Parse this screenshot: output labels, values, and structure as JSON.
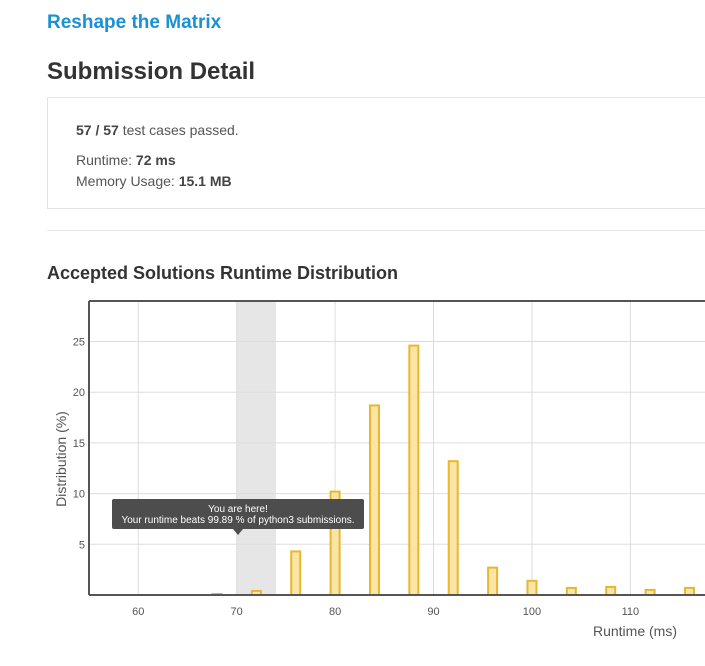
{
  "problem": {
    "title": "Reshape the Matrix"
  },
  "page_title": "Submission Detail",
  "summary": {
    "passed": "57",
    "separator": " / ",
    "total": "57",
    "passed_suffix": " test cases passed.",
    "runtime_label": "Runtime: ",
    "runtime_value": "72 ms",
    "memory_label": "Memory Usage: ",
    "memory_value": "15.1 MB"
  },
  "section_title": "Accepted Solutions Runtime Distribution",
  "tooltip": {
    "line1": "You are here!",
    "line2": "Your runtime beats 99.89 % of python3 submissions."
  },
  "colors": {
    "link": "#1a90d6",
    "bar_fill": "#fbe5a6",
    "bar_stroke": "#e7b72e",
    "highlight_band": "#e6e6e6",
    "tooltip_bg": "#4d4d4d"
  },
  "chart_data": {
    "type": "bar",
    "xlabel": "Runtime (ms)",
    "ylabel": "Distribution (%)",
    "xlim": [
      55,
      119
    ],
    "ylim": [
      0,
      29
    ],
    "x_ticks": [
      60,
      70,
      80,
      90,
      100,
      110
    ],
    "y_ticks": [
      5,
      10,
      15,
      20,
      25
    ],
    "grid": true,
    "highlight_range": [
      70,
      74
    ],
    "x": [
      68,
      72,
      76,
      80,
      84,
      88,
      92,
      96,
      100,
      104,
      108,
      112,
      116
    ],
    "values": [
      0.1,
      0.4,
      4.3,
      10.2,
      18.7,
      24.6,
      13.2,
      2.7,
      1.4,
      0.7,
      0.8,
      0.5,
      0.7
    ]
  }
}
